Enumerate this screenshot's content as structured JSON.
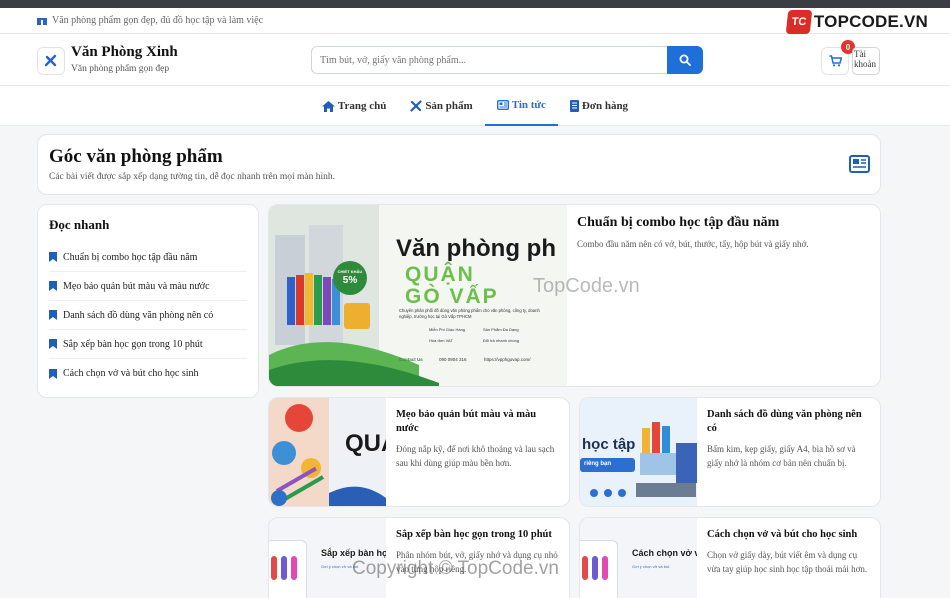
{
  "notice": {
    "text": "Văn phòng phẩm gọn đẹp, đủ đồ học tập và làm việc"
  },
  "brand_badge": {
    "mark": "TC",
    "text": "TOPCODE.VN"
  },
  "header": {
    "title": "Văn Phòng Xinh",
    "subtitle": "Văn phòng phẩm gọn đẹp",
    "search_placeholder": "Tìm bút, vở, giấy văn phòng phẩm...",
    "cart_count": "0",
    "avatar_alt": "Tài khoản"
  },
  "nav": [
    {
      "label": "Trang chủ",
      "icon": "home-icon",
      "active": false
    },
    {
      "label": "Sản phẩm",
      "icon": "tools-icon",
      "active": false
    },
    {
      "label": "Tin tức",
      "icon": "newspaper-icon",
      "active": true
    },
    {
      "label": "Đơn hàng",
      "icon": "receipt-icon",
      "active": false
    }
  ],
  "page": {
    "title": "Góc văn phòng phẩm",
    "subtitle": "Các bài viết được sắp xếp dạng tường tin, dễ đọc nhanh trên mọi màn hình."
  },
  "sidebar": {
    "title": "Đọc nhanh",
    "items": [
      "Chuẩn bị combo học tập đầu năm",
      "Mẹo bảo quản bút màu và màu nước",
      "Danh sách đồ dùng văn phòng nên có",
      "Sắp xếp bàn học gọn trong 10 phút",
      "Cách chọn vở và bút cho học sinh"
    ]
  },
  "featured": {
    "title": "Chuẩn bị combo học tập đầu năm",
    "desc": "Combo đầu năm nên có vở, bút, thước, tẩy, hộp bút và giấy nhớ.",
    "banner": {
      "heading": "Văn phòng ph",
      "line1": "QUẬN",
      "line2": "GÒ VẤP",
      "badge_top": "CHIẾT KHẤU",
      "badge_pct": "5%",
      "blurb": "Chuyên phân phối đồ dùng văn phòng phẩm cho văn phòng, công ty, doanh nghiệp, trường học tại Gò Vấp TPHCM",
      "feature1": "Miễn Phí Giao Hàng",
      "feature2": "Sản Phẩm Đa Dạng",
      "feature3": "Hóa đơn VAT",
      "feature4": "Đổi trả nhanh chóng",
      "contact": "Contact Us",
      "phone": "090 0904 316",
      "site": "https://vpphgovap.com/"
    }
  },
  "posts": [
    {
      "title": "Mẹo bảo quản bút màu và màu nước",
      "desc": "Đóng nắp kỹ, để nơi khô thoáng và lau sạch sau khi dùng giúp màu bền hơn.",
      "thumb": {
        "text": "QUẠ"
      }
    },
    {
      "title": "Danh sách đồ dùng văn phòng nên có",
      "desc": "Bấm kim, kẹp giấy, giấy A4, bìa hồ sơ và giấy nhớ là nhóm cơ bản nên chuẩn bị.",
      "thumb": {
        "text": "học tập",
        "sub": "riêng bạn"
      }
    },
    {
      "title": "Sắp xếp bàn học gọn trong 10 phút",
      "desc": "Phân nhóm bút, vở, giấy nhớ và dụng cụ nhỏ vào từng hộp riêng.",
      "thumb": {
        "text": "Sắp xếp bàn họ",
        "sub": "Gợi ý chọn vở và bút"
      }
    },
    {
      "title": "Cách chọn vở và bút cho học sinh",
      "desc": "Chọn vở giấy dày, bút viết êm và dụng cụ vừa tay giúp học sinh học tập thoải mái hơn.",
      "thumb": {
        "text": "Cách chọn vở v",
        "sub": "Gợi ý chọn vở và bút"
      }
    }
  ],
  "watermarks": {
    "center": "TopCode.vn",
    "bottom": "Copyright © TopCode.vn"
  },
  "colors": {
    "accent": "#1f6fd8",
    "badge_red": "#e0342c",
    "banner_green": "#2e8b3c"
  }
}
